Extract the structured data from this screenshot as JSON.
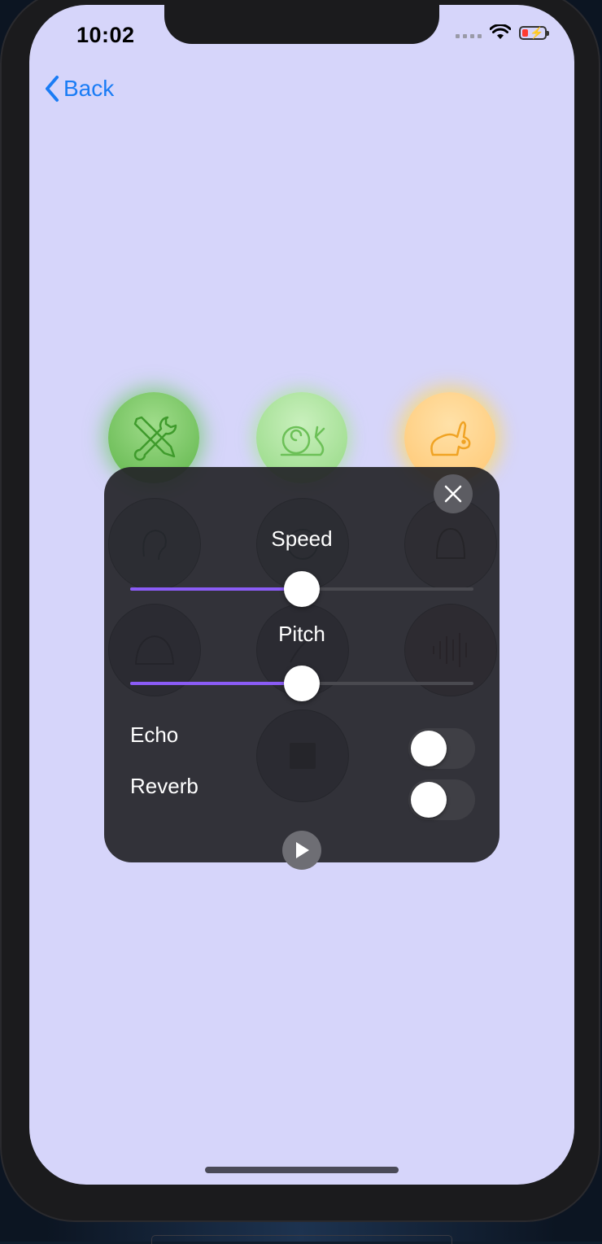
{
  "status_bar": {
    "time": "10:02"
  },
  "nav": {
    "back_label": "Back"
  },
  "effects": {
    "row1": [
      "tools-icon",
      "snail-icon",
      "rabbit-icon"
    ],
    "row2": [
      "ear-icon",
      "squirrel-icon",
      "vader-icon"
    ],
    "row3": [
      "cave-icon",
      "bird-icon",
      "waveform-icon"
    ],
    "stop": "stop-icon"
  },
  "panel": {
    "speed_label": "Speed",
    "speed_value": 0.5,
    "pitch_label": "Pitch",
    "pitch_value": 0.5,
    "echo_label": "Echo",
    "echo_on": false,
    "reverb_label": "Reverb",
    "reverb_on": false,
    "accent_color": "#8b5cf6"
  },
  "colors": {
    "screen_bg": "#d6d5fa",
    "back_blue": "#1a7cf5"
  }
}
